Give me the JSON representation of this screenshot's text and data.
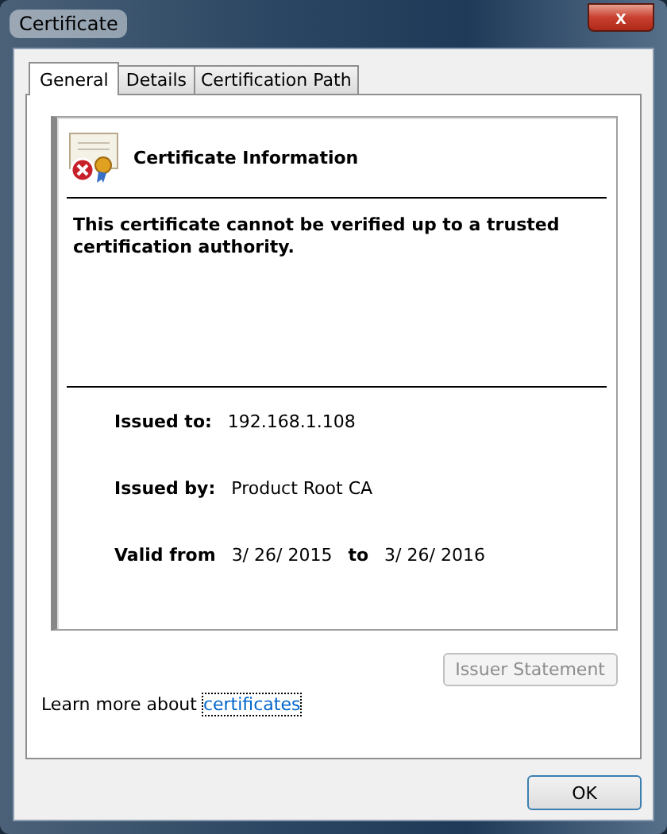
{
  "window": {
    "title": "Certificate",
    "close": "x"
  },
  "tabs": [
    {
      "label": "General",
      "selected": true
    },
    {
      "label": "Details",
      "selected": false
    },
    {
      "label": "Certification Path",
      "selected": false
    }
  ],
  "info": {
    "heading": "Certificate Information",
    "message": "This certificate cannot be verified up to a trusted certification authority.",
    "fields": [
      {
        "label": "Issued to:",
        "value": "192.168.1.108"
      },
      {
        "label": "Issued by:",
        "value": "Product Root CA"
      }
    ],
    "validity": {
      "label": "Valid from",
      "from": "3/ 26/ 2015",
      "separator": "to",
      "to": "3/ 26/ 2016"
    }
  },
  "issuer_statement": {
    "label": "Issuer Statement",
    "disabled": true
  },
  "learn_more": {
    "text": "Learn more about",
    "link": "certificates"
  },
  "buttons": [
    "OK"
  ]
}
